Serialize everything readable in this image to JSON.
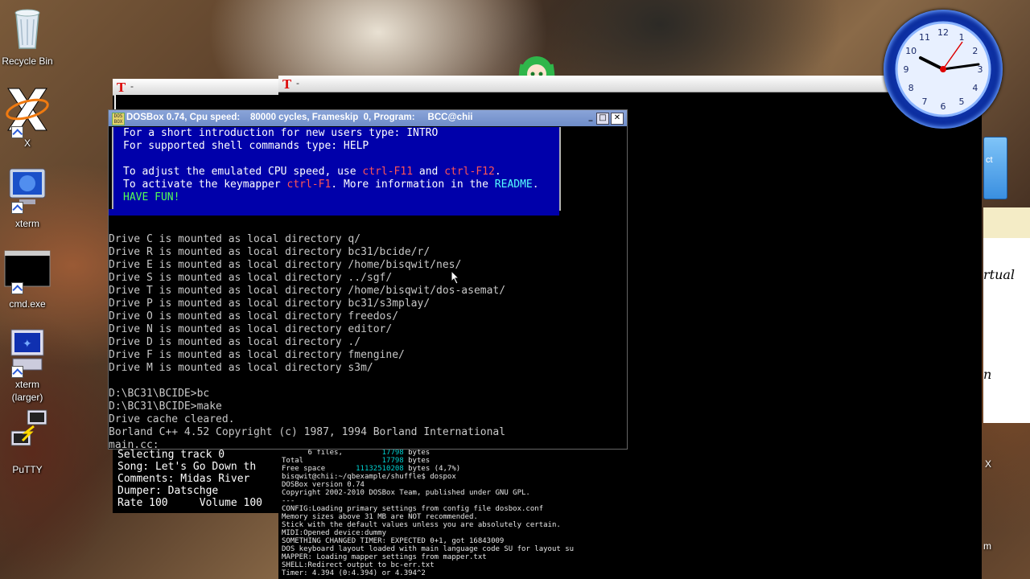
{
  "desktop_icons": [
    {
      "id": "recycle-bin",
      "label": "Recycle Bin",
      "icon": "recycle-bin-icon"
    },
    {
      "id": "x",
      "label": "X",
      "icon": "x-logo-icon"
    },
    {
      "id": "xterm",
      "label": "xterm",
      "icon": "monitor-icon"
    },
    {
      "id": "cmd",
      "label": "cmd.exe",
      "icon": "console-icon"
    },
    {
      "id": "xterm-larger",
      "label": "xterm\n(larger)",
      "icon": "computer-icon"
    },
    {
      "id": "putty",
      "label": "PuTTY",
      "icon": "putty-icon"
    }
  ],
  "xterm_left": {
    "title": "-"
  },
  "xterm_right": {
    "title": "-"
  },
  "dosbox": {
    "title": "DOSBox 0.74, Cpu speed:    80000 cycles, Frameskip  0, Program:     BCC@chii",
    "welcome": [
      {
        "t": "For a short introduction for new users type: INTRO"
      },
      {
        "t": "For supported shell commands type: HELP"
      },
      {
        "t": ""
      },
      {
        "t": "To adjust the emulated CPU speed, use ",
        "r1": "ctrl-F11",
        "m1": " and ",
        "r2": "ctrl-F12",
        "e": "."
      },
      {
        "t": "To activate the keymapper ",
        "r1": "ctrl-F1",
        "m1": ". More information in the ",
        "c1": "README",
        "e": "."
      },
      {
        "g": "HAVE FUN!"
      }
    ],
    "mounts": [
      "Drive C is mounted as local directory q/",
      "Drive R is mounted as local directory bc31/bcide/r/",
      "Drive E is mounted as local directory /home/bisqwit/nes/",
      "Drive S is mounted as local directory ../sgf/",
      "Drive T is mounted as local directory /home/bisqwit/dos-asemat/",
      "Drive P is mounted as local directory bc31/s3mplay/",
      "Drive O is mounted as local directory freedos/",
      "Drive N is mounted as local directory editor/",
      "Drive D is mounted as local directory ./",
      "Drive F is mounted as local directory fmengine/",
      "Drive M is mounted as local directory s3m/",
      "",
      "D:\\BC31\\BCIDE>bc",
      "D:\\BC31\\BCIDE>make",
      "Drive cache cleared.",
      "Borland C++ 4.52 Copyright (c) 1987, 1994 Borland International",
      "main.cc:"
    ]
  },
  "track_panel": [
    "Selecting track 0",
    "Song: Let's Go Down th",
    "Comments: Midas River",
    "Dumper: Datschge",
    "Rate 100     Volume 100"
  ],
  "bg_terminal": [
    {
      "a": "      6 files,         ",
      "b": "17798",
      "c": " bytes"
    },
    {
      "a": "Total                  ",
      "b": "17798",
      "c": " bytes"
    },
    {
      "a": "Free space       ",
      "b": "11132510208",
      "c": " bytes (4,7%)"
    },
    {
      "a": "bisqwit@chii:~/qbexample/shuffle$ dospox"
    },
    {
      "a": "DOSBox version 0.74"
    },
    {
      "a": "Copyright 2002-2010 DOSBox Team, published under GNU GPL."
    },
    {
      "a": "---"
    },
    {
      "a": "CONFIG:Loading primary settings from config file dosbox.conf"
    },
    {
      "a": "Memory sizes above 31 MB are NOT recommended."
    },
    {
      "a": "Stick with the default values unless you are absolutely certain."
    },
    {
      "a": "MIDI:Opened device:dummy"
    },
    {
      "a": "SOMETHING CHANGED TIMER: EXPECTED 0+1, got 16843009"
    },
    {
      "a": "DOS keyboard layout loaded with main language code SU for layout su"
    },
    {
      "a": "MAPPER: Loading mapper settings from mapper.txt"
    },
    {
      "a": "SHELL:Redirect output to bc-err.txt"
    },
    {
      "a": "Timer: 4.394 (0:4.394) or 4.394^2"
    }
  ],
  "side_doc": {
    "word1": "rtual",
    "word2": "n",
    "letter": "X",
    "letter2": "m"
  },
  "clock": {
    "numbers": [
      "12",
      "1",
      "2",
      "3",
      "4",
      "5",
      "6",
      "7",
      "8",
      "9",
      "10",
      "11"
    ]
  }
}
